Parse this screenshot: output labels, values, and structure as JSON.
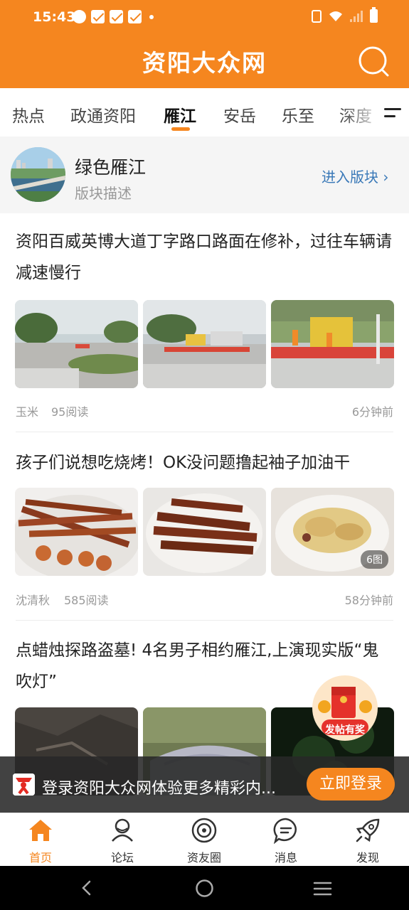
{
  "status_bar": {
    "time": "15:43"
  },
  "header": {
    "title": "资阳大众网"
  },
  "tabs": [
    {
      "label": "热点"
    },
    {
      "label": "政通资阳"
    },
    {
      "label": "雁江"
    },
    {
      "label": "安岳"
    },
    {
      "label": "乐至"
    },
    {
      "label": "深度"
    }
  ],
  "board": {
    "name": "绿色雁江",
    "description": "版块描述",
    "enter_label": "进入版块 ›"
  },
  "articles": [
    {
      "title": "资阳百威英博大道丁字路口路面在修补，过往车辆请减速慢行",
      "author": "玉米",
      "reads": "95阅读",
      "time": "6分钟前",
      "image_count": ""
    },
    {
      "title": "孩子们说想吃烧烤！OK没问题撸起袖子加油干",
      "author": "沈清秋",
      "reads": "585阅读",
      "time": "58分钟前",
      "image_count": "6图"
    },
    {
      "title": "点蜡烛探路盗墓! 4名男子相约雁江,上演现实版“鬼吹灯”",
      "author": "",
      "reads": "",
      "time": "",
      "image_count": ""
    }
  ],
  "promo": {
    "label": "发帖有奖"
  },
  "login_banner": {
    "text": "登录资阳大众网体验更多精彩内...",
    "button": "立即登录"
  },
  "bottom_nav": [
    {
      "label": "首页",
      "icon": "home-icon"
    },
    {
      "label": "论坛",
      "icon": "forum-icon"
    },
    {
      "label": "资友圈",
      "icon": "circle-icon"
    },
    {
      "label": "消息",
      "icon": "message-icon"
    },
    {
      "label": "发现",
      "icon": "rocket-icon"
    }
  ],
  "colors": {
    "brand": "#f5861f",
    "link": "#3a79b8"
  }
}
